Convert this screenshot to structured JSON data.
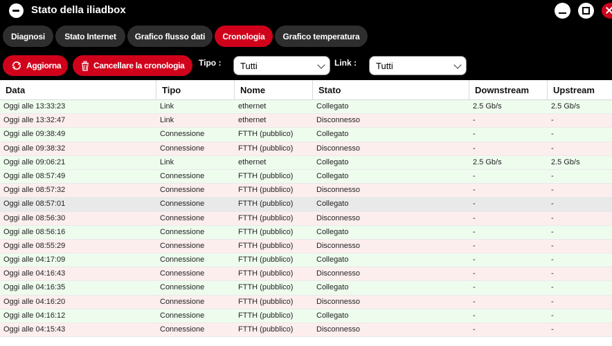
{
  "window": {
    "title": "Stato della iliadbox",
    "icon": "app-logo-icon",
    "controls": [
      "minimize-icon",
      "maximize-icon",
      "close-icon"
    ]
  },
  "tabs": [
    {
      "label": "Diagnosi",
      "active": false
    },
    {
      "label": "Stato Internet",
      "active": false
    },
    {
      "label": "Grafico flusso dati",
      "active": false
    },
    {
      "label": "Cronologia",
      "active": true
    },
    {
      "label": "Grafico temperatura",
      "active": false
    }
  ],
  "toolbar": {
    "refresh_label": "Aggiorna",
    "clear_label": "Cancellare la cronologia",
    "type_label": "Tipo :",
    "type_value": "Tutti",
    "link_label": "Link :",
    "link_value": "Tutti"
  },
  "colors": {
    "accent": "#d0021b",
    "tab_bg": "#2e2e2e",
    "row_connected": "#eefcee",
    "row_disconnected": "#fdeeee",
    "row_selected": "#e9e9e9"
  },
  "table": {
    "headers": [
      "Data",
      "Tipo",
      "Nome",
      "Stato",
      "Downstream",
      "Upstream"
    ],
    "rows": [
      [
        "Oggi alle 13:33:23",
        "Link",
        "ethernet",
        "Collegato",
        "2.5 Gb/s",
        "2.5 Gb/s"
      ],
      [
        "Oggi alle 13:32:47",
        "Link",
        "ethernet",
        "Disconnesso",
        "-",
        "-"
      ],
      [
        "Oggi alle 09:38:49",
        "Connessione",
        "FTTH (pubblico)",
        "Collegato",
        "-",
        "-"
      ],
      [
        "Oggi alle 09:38:32",
        "Connessione",
        "FTTH (pubblico)",
        "Disconnesso",
        "-",
        "-"
      ],
      [
        "Oggi alle 09:06:21",
        "Link",
        "ethernet",
        "Collegato",
        "2.5 Gb/s",
        "2.5 Gb/s"
      ],
      [
        "Oggi alle 08:57:49",
        "Connessione",
        "FTTH (pubblico)",
        "Collegato",
        "-",
        "-"
      ],
      [
        "Oggi alle 08:57:32",
        "Connessione",
        "FTTH (pubblico)",
        "Disconnesso",
        "-",
        "-"
      ],
      [
        "Oggi alle 08:57:01",
        "Connessione",
        "FTTH (pubblico)",
        "Collegato",
        "-",
        "-"
      ],
      [
        "Oggi alle 08:56:30",
        "Connessione",
        "FTTH (pubblico)",
        "Disconnesso",
        "-",
        "-"
      ],
      [
        "Oggi alle 08:56:16",
        "Connessione",
        "FTTH (pubblico)",
        "Collegato",
        "-",
        "-"
      ],
      [
        "Oggi alle 08:55:29",
        "Connessione",
        "FTTH (pubblico)",
        "Disconnesso",
        "-",
        "-"
      ],
      [
        "Oggi alle 04:17:09",
        "Connessione",
        "FTTH (pubblico)",
        "Collegato",
        "-",
        "-"
      ],
      [
        "Oggi alle 04:16:43",
        "Connessione",
        "FTTH (pubblico)",
        "Disconnesso",
        "-",
        "-"
      ],
      [
        "Oggi alle 04:16:35",
        "Connessione",
        "FTTH (pubblico)",
        "Collegato",
        "-",
        "-"
      ],
      [
        "Oggi alle 04:16:20",
        "Connessione",
        "FTTH (pubblico)",
        "Disconnesso",
        "-",
        "-"
      ],
      [
        "Oggi alle 04:16:12",
        "Connessione",
        "FTTH (pubblico)",
        "Collegato",
        "-",
        "-"
      ],
      [
        "Oggi alle 04:15:43",
        "Connessione",
        "FTTH (pubblico)",
        "Disconnesso",
        "-",
        "-"
      ]
    ]
  }
}
